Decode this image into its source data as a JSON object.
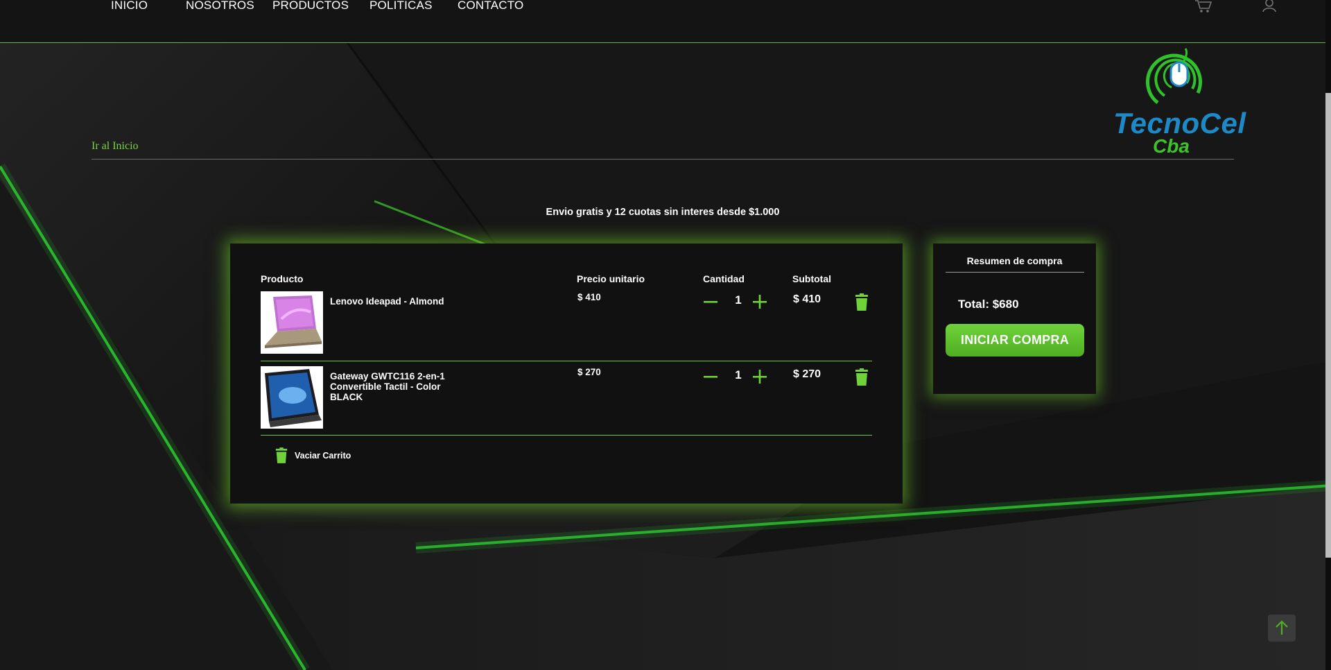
{
  "nav": {
    "links": [
      "INICIO",
      "NOSOTROS",
      "PRODUCTOS",
      "POLITICAS",
      "CONTACTO"
    ]
  },
  "logo": {
    "line1": "TecnoCel",
    "line2": "Cba"
  },
  "back_link": "Ir al Inicio",
  "promo": "Envio gratis y 12 cuotas sin interes desde $1.000",
  "cart": {
    "headers": {
      "product": "Producto",
      "unit_price": "Precio unitario",
      "quantity": "Cantidad",
      "subtotal": "Subtotal"
    },
    "items": [
      {
        "name": "Lenovo Ideapad - Almond",
        "unit_price": "$ 410",
        "quantity": "1",
        "subtotal": "$ 410"
      },
      {
        "name": "Gateway GWTC116 2-en-1 Convertible Tactil - Color BLACK",
        "unit_price": "$ 270",
        "quantity": "1",
        "subtotal": "$ 270"
      }
    ],
    "empty_label": "Vaciar Carrito"
  },
  "summary": {
    "title": "Resumen de compra",
    "total": "Total: $680",
    "button": "INICIAR COMPRA"
  },
  "colors": {
    "accent": "#6fd23a",
    "glow": "#78dc28",
    "background": "#141414"
  },
  "icons": [
    "cart-icon",
    "user-icon",
    "minus-icon",
    "plus-icon",
    "trash-icon",
    "arrow-up-icon",
    "mouse-logo-icon"
  ]
}
